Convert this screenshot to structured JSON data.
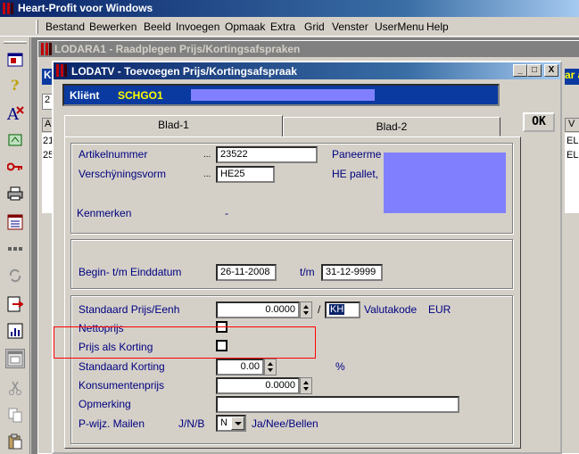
{
  "app": {
    "title": "Heart-Profit voor Windows",
    "menu": [
      "Bestand",
      "Bewerken",
      "Beeld",
      "Invoegen",
      "Opmaak",
      "Extra",
      "Grid",
      "Venster",
      "UserMenu",
      "Help"
    ]
  },
  "background_window": {
    "title": "LODARA1 - Raadplegen Prijs/Kortingsafspraken",
    "fragments": [
      "K",
      "2",
      "A",
      "21",
      "25",
      "ar ak",
      "V",
      "EL",
      "EL"
    ]
  },
  "dialog": {
    "title": "LODATV - Toevoegen Prijs/Kortingsafspraak",
    "window_buttons": [
      "_",
      "□",
      "X"
    ],
    "klient_label": "Kliënt",
    "klient_value": "SCHGO1",
    "ok_label": "OK",
    "tabs": [
      "Blad-1",
      "Blad-2"
    ],
    "fields": {
      "artikelnummer_label": "Artikelnummer",
      "artikelnummer_dots": "...",
      "artikelnummer_value": "23522",
      "paneerme_label": "Paneerme",
      "verschijningsvorm_label": "Verschÿningsvorm",
      "verschijningsvorm_dots": "...",
      "verschijningsvorm_value": "HE25",
      "he_pallet_label": "HE pallet,",
      "kenmerken_label": "Kenmerken",
      "kenmerken_value": "-",
      "begin_label": "Begin- t/m Einddatum",
      "begin_value": "26-11-2008",
      "tm_label": "t/m",
      "eind_value": "31-12-9999",
      "std_prijs_label": "Standaard Prijs/Eenh",
      "std_prijs_value": "0.0000",
      "slash": "/",
      "eenheid_value": "KH",
      "valutakode_label": "Valutakode",
      "valuta_value": "EUR",
      "nettoprijs_label": "Nettoprijs",
      "prijs_als_korting_label": "Prijs als Korting",
      "std_korting_label": "Standaard Korting",
      "std_korting_value": "0.00",
      "percent": "%",
      "konsumentenprijs_label": "Konsumentenprijs",
      "konsumentenprijs_value": "0.0000",
      "opmerking_label": "Opmerking",
      "opmerking_value": "",
      "pwijz_label": "P-wijz. Mailen",
      "jnb_label": "J/N/B",
      "pwijz_value": "N",
      "pwijz_hint": "Ja/Nee/Bellen"
    }
  },
  "colors": {
    "title_active": "#0a246a",
    "title_inactive": "#808080",
    "label_blue": "#000080",
    "highlight_red": "#ff0000",
    "redact_block": "#8080ff",
    "window_bg": "#d4d0c8"
  }
}
